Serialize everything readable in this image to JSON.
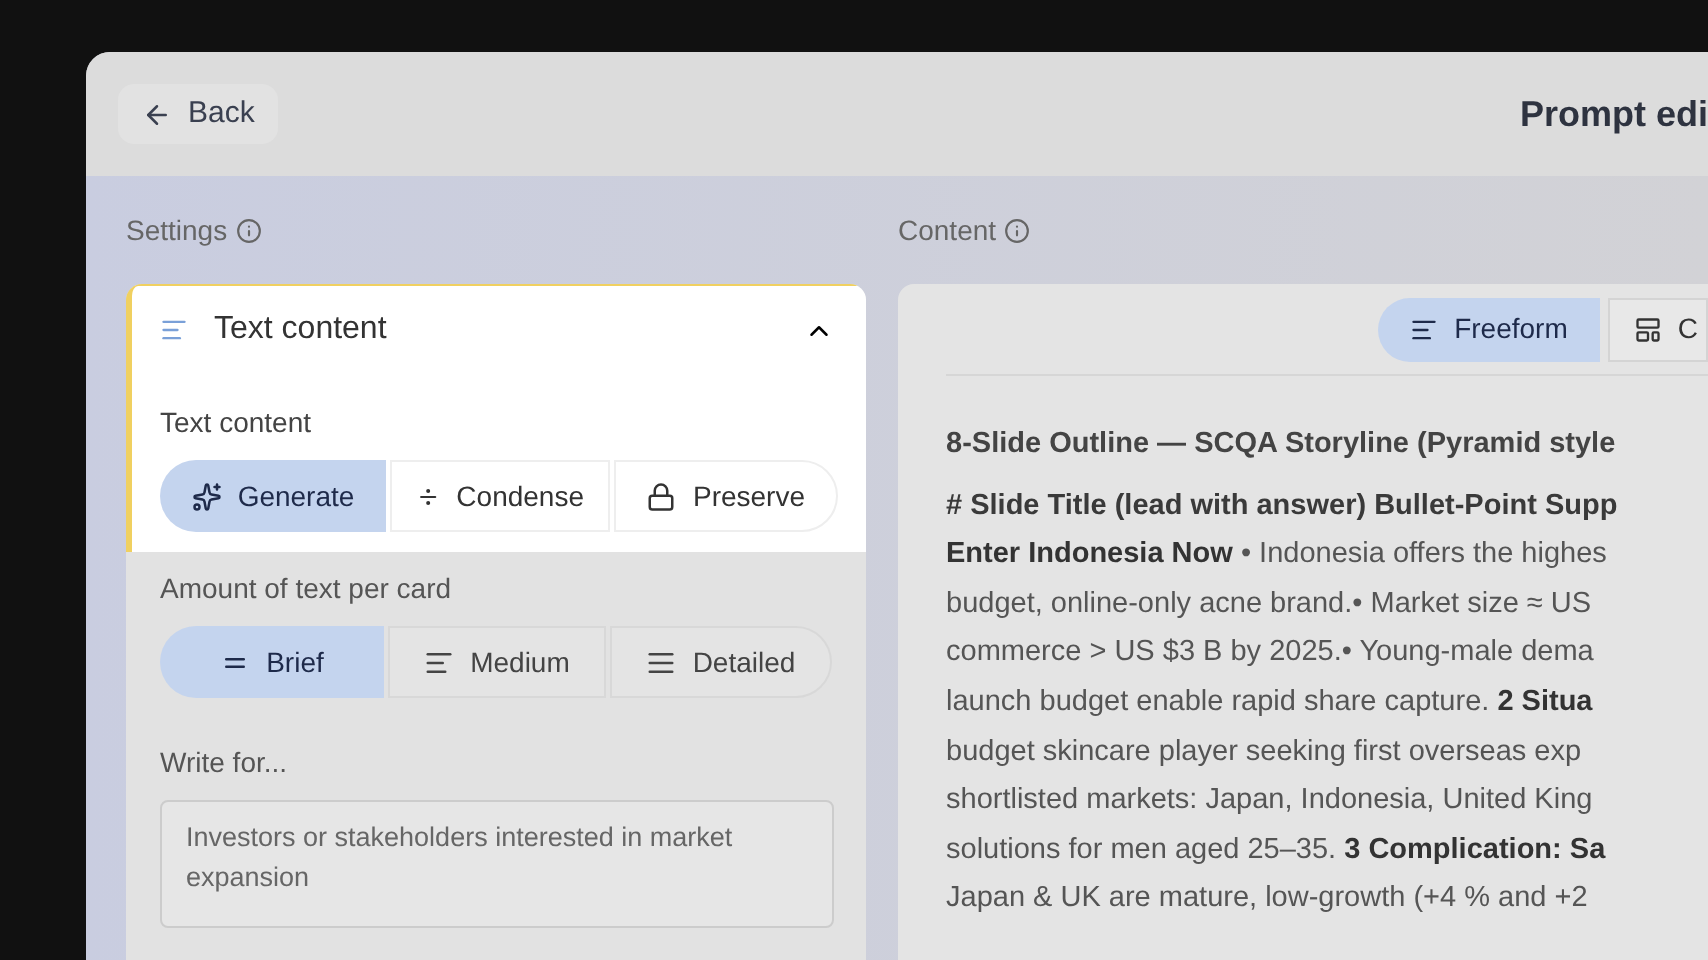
{
  "header": {
    "back_label": "Back",
    "title": "Prompt edi"
  },
  "settings": {
    "label": "Settings",
    "card": {
      "title": "Text content",
      "expanded": true,
      "text_content": {
        "label": "Text content",
        "options": [
          {
            "label": "Generate",
            "selected": true
          },
          {
            "label": "Condense",
            "selected": false
          },
          {
            "label": "Preserve",
            "selected": false
          }
        ]
      },
      "amount": {
        "label": "Amount of text per card",
        "options": [
          {
            "label": "Brief",
            "selected": true
          },
          {
            "label": "Medium",
            "selected": false
          },
          {
            "label": "Detailed",
            "selected": false
          }
        ]
      },
      "write_for": {
        "label": "Write for...",
        "value": "Investors or stakeholders interested in market expansion"
      }
    }
  },
  "content": {
    "label": "Content",
    "tabs": [
      {
        "label": "Freeform",
        "selected": true
      },
      {
        "label": "C",
        "selected": false
      }
    ],
    "lines": [
      {
        "kind": "heading",
        "text": "8-Slide Outline — SCQA Storyline (Pyramid style"
      },
      {
        "kind": "bold",
        "text": "# Slide Title (lead with answer) Bullet-Point Supp"
      },
      {
        "kind": "body",
        "text": "**Enter Indonesia Now** • Indonesia offers the highes"
      },
      {
        "kind": "body",
        "text": "budget, online-only acne brand.• Market size ≈ US"
      },
      {
        "kind": "body",
        "text": "commerce > US $3 B by 2025.• Young-male dema"
      },
      {
        "kind": "body",
        "text": "launch budget enable rapid share capture. **2 Situa**"
      },
      {
        "kind": "body",
        "text": "budget skincare player seeking first overseas exp"
      },
      {
        "kind": "body",
        "text": "shortlisted markets: Japan, Indonesia, United King"
      },
      {
        "kind": "body",
        "text": "solutions for men aged 25–35. **3 Complication: Sa**"
      },
      {
        "kind": "body",
        "text": "Japan & UK are mature, low-growth (+4 % and +2"
      }
    ]
  }
}
